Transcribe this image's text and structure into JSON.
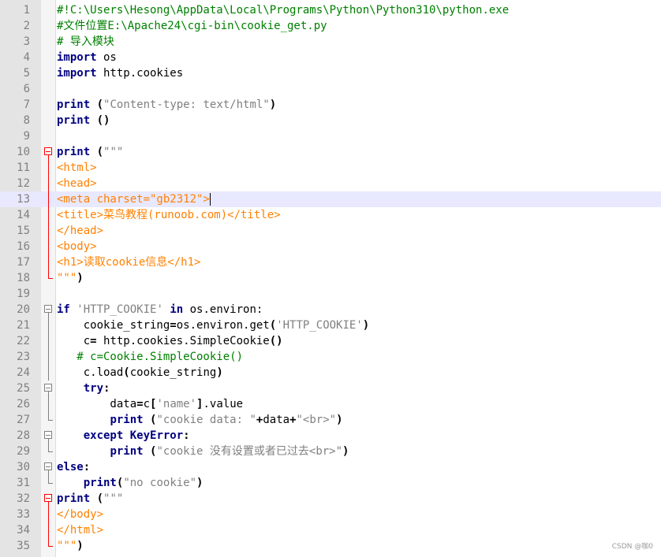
{
  "lines": [
    {
      "n": "1",
      "fold": "",
      "parts": [
        [
          "cmt",
          "#!C:\\Users\\Hesong\\AppData\\Local\\Programs\\Python\\Python310\\python.exe"
        ]
      ]
    },
    {
      "n": "2",
      "fold": "",
      "parts": [
        [
          "cmt",
          "#文件位置E:\\Apache24\\cgi-bin\\cookie_get.py"
        ]
      ]
    },
    {
      "n": "3",
      "fold": "",
      "parts": [
        [
          "cmt",
          "# 导入模块"
        ]
      ]
    },
    {
      "n": "4",
      "fold": "",
      "parts": [
        [
          "kw",
          "import"
        ],
        [
          "id",
          " os"
        ]
      ]
    },
    {
      "n": "5",
      "fold": "",
      "parts": [
        [
          "kw",
          "import"
        ],
        [
          "id",
          " http.cookies"
        ]
      ]
    },
    {
      "n": "6",
      "fold": "",
      "parts": []
    },
    {
      "n": "7",
      "fold": "",
      "parts": [
        [
          "kw",
          "print"
        ],
        [
          "id",
          " "
        ],
        [
          "op",
          "("
        ],
        [
          "str",
          "\"Content-type: text/html\""
        ],
        [
          "op",
          ")"
        ]
      ]
    },
    {
      "n": "8",
      "fold": "",
      "parts": [
        [
          "kw",
          "print"
        ],
        [
          "id",
          " "
        ],
        [
          "op",
          "()"
        ]
      ]
    },
    {
      "n": "9",
      "fold": "",
      "parts": []
    },
    {
      "n": "10",
      "fold": "box-red",
      "parts": [
        [
          "kw",
          "print"
        ],
        [
          "id",
          " "
        ],
        [
          "op",
          "("
        ],
        [
          "str",
          "\"\"\""
        ]
      ]
    },
    {
      "n": "11",
      "fold": "line-red",
      "parts": [
        [
          "html",
          "<html>"
        ]
      ]
    },
    {
      "n": "12",
      "fold": "line-red",
      "parts": [
        [
          "html",
          "<head>"
        ]
      ]
    },
    {
      "n": "13",
      "fold": "line-red",
      "current": true,
      "parts": [
        [
          "html",
          "<meta charset=\"gb2312\">"
        ],
        [
          "caret",
          ""
        ]
      ]
    },
    {
      "n": "14",
      "fold": "line-red",
      "parts": [
        [
          "html",
          "<title>菜鸟教程(runoob.com)</title>"
        ]
      ]
    },
    {
      "n": "15",
      "fold": "line-red",
      "parts": [
        [
          "html",
          "</head>"
        ]
      ]
    },
    {
      "n": "16",
      "fold": "line-red",
      "parts": [
        [
          "html",
          "<body>"
        ]
      ]
    },
    {
      "n": "17",
      "fold": "line-red",
      "parts": [
        [
          "html",
          "<h1>读取cookie信息</h1>"
        ]
      ]
    },
    {
      "n": "18",
      "fold": "end-red",
      "parts": [
        [
          "html",
          "\"\"\""
        ],
        [
          "op",
          ")"
        ]
      ]
    },
    {
      "n": "19",
      "fold": "",
      "parts": []
    },
    {
      "n": "20",
      "fold": "box",
      "parts": [
        [
          "kw",
          "if"
        ],
        [
          "id",
          " "
        ],
        [
          "str",
          "'HTTP_COOKIE'"
        ],
        [
          "id",
          " "
        ],
        [
          "kw",
          "in"
        ],
        [
          "id",
          " os.environ:"
        ]
      ]
    },
    {
      "n": "21",
      "fold": "line",
      "parts": [
        [
          "id",
          "    cookie_string"
        ],
        [
          "op",
          "="
        ],
        [
          "id",
          "os.environ.get"
        ],
        [
          "op",
          "("
        ],
        [
          "str",
          "'HTTP_COOKIE'"
        ],
        [
          "op",
          ")"
        ]
      ]
    },
    {
      "n": "22",
      "fold": "line",
      "parts": [
        [
          "id",
          "    c"
        ],
        [
          "op",
          "="
        ],
        [
          "id",
          " http.cookies.SimpleCookie"
        ],
        [
          "op",
          "()"
        ]
      ]
    },
    {
      "n": "23",
      "fold": "line",
      "parts": [
        [
          "cmt",
          "   # c=Cookie.SimpleCookie()"
        ]
      ]
    },
    {
      "n": "24",
      "fold": "line",
      "parts": [
        [
          "id",
          "    c.load"
        ],
        [
          "op",
          "("
        ],
        [
          "id",
          "cookie_string"
        ],
        [
          "op",
          ")"
        ]
      ]
    },
    {
      "n": "25",
      "fold": "box",
      "parts": [
        [
          "id",
          "    "
        ],
        [
          "kw",
          "try"
        ],
        [
          "op",
          ":"
        ]
      ]
    },
    {
      "n": "26",
      "fold": "line",
      "parts": [
        [
          "id",
          "        data"
        ],
        [
          "op",
          "="
        ],
        [
          "id",
          "c"
        ],
        [
          "op",
          "["
        ],
        [
          "str",
          "'name'"
        ],
        [
          "op",
          "]"
        ],
        [
          "id",
          ".value"
        ]
      ]
    },
    {
      "n": "27",
      "fold": "end",
      "parts": [
        [
          "id",
          "        "
        ],
        [
          "kw",
          "print"
        ],
        [
          "id",
          " "
        ],
        [
          "op",
          "("
        ],
        [
          "str",
          "\"cookie data: \""
        ],
        [
          "op",
          "+"
        ],
        [
          "id",
          "data"
        ],
        [
          "op",
          "+"
        ],
        [
          "str",
          "\"<br>\""
        ],
        [
          "op",
          ")"
        ]
      ]
    },
    {
      "n": "28",
      "fold": "box",
      "parts": [
        [
          "id",
          "    "
        ],
        [
          "kw",
          "except"
        ],
        [
          "id",
          " "
        ],
        [
          "kw",
          "KeyError"
        ],
        [
          "op",
          ":"
        ]
      ]
    },
    {
      "n": "29",
      "fold": "end",
      "parts": [
        [
          "id",
          "        "
        ],
        [
          "kw",
          "print"
        ],
        [
          "id",
          " "
        ],
        [
          "op",
          "("
        ],
        [
          "str",
          "\"cookie 没有设置或者已过去<br>\""
        ],
        [
          "op",
          ")"
        ]
      ]
    },
    {
      "n": "30",
      "fold": "box",
      "parts": [
        [
          "kw",
          "else"
        ],
        [
          "op",
          ":"
        ]
      ]
    },
    {
      "n": "31",
      "fold": "end",
      "parts": [
        [
          "id",
          "    "
        ],
        [
          "kw",
          "print"
        ],
        [
          "op",
          "("
        ],
        [
          "str",
          "\"no cookie\""
        ],
        [
          "op",
          ")"
        ]
      ]
    },
    {
      "n": "32",
      "fold": "box-red",
      "parts": [
        [
          "kw",
          "print"
        ],
        [
          "id",
          " "
        ],
        [
          "op",
          "("
        ],
        [
          "str",
          "\"\"\""
        ]
      ]
    },
    {
      "n": "33",
      "fold": "line-red",
      "parts": [
        [
          "html",
          "</body>"
        ]
      ]
    },
    {
      "n": "34",
      "fold": "line-red",
      "parts": [
        [
          "html",
          "</html>"
        ]
      ]
    },
    {
      "n": "35",
      "fold": "end-red",
      "parts": [
        [
          "html",
          "\"\"\""
        ],
        [
          "op",
          ")"
        ]
      ]
    }
  ],
  "watermark": "CSDN @咖0"
}
